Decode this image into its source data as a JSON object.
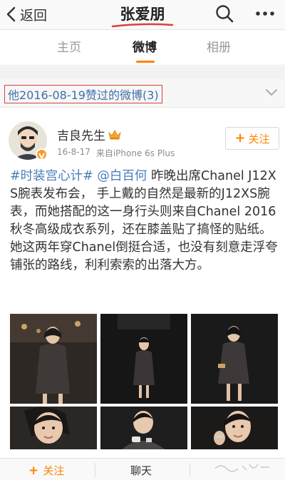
{
  "nav": {
    "back_label": "返回",
    "title": "张爱朋",
    "accent_color": "#ff8200",
    "annotation_color": "#d94040"
  },
  "tabs": [
    {
      "label": "主页",
      "active": false
    },
    {
      "label": "微博",
      "active": true
    },
    {
      "label": "相册",
      "active": false
    }
  ],
  "filter": {
    "label": "他2016-08-19赞过的微博(3)"
  },
  "post": {
    "author": "吉良先生",
    "date": "16-8-17",
    "source": "来自iPhone 6s Plus",
    "follow_plus": "+",
    "follow_label": "关注",
    "text": {
      "tag": "#时装宫心计#",
      "mention": "@白百何",
      "body": " 昨晚出席Chanel J12XS腕表发布会， 手上戴的自然是最新的J12XS腕表，而她搭配的这一身行头则来自Chanel 2016秋冬高级成衣系列，还在膝盖贴了搞怪的贴纸。她这两年穿Chanel倒挺合适，也没有刻意走浮夸铺张的路线，利利索索的出落大方。"
    },
    "photo_count": 6
  },
  "bottom_bar": {
    "follow_plus": "+",
    "follow_label": "关注",
    "chat_label": "聊天"
  },
  "icons": {
    "back": "chevron-left-icon",
    "search": "search-icon",
    "more": "more-icon",
    "filter": "chevron-down-icon",
    "verified": "verified-badge-icon",
    "crown": "crown-icon"
  }
}
